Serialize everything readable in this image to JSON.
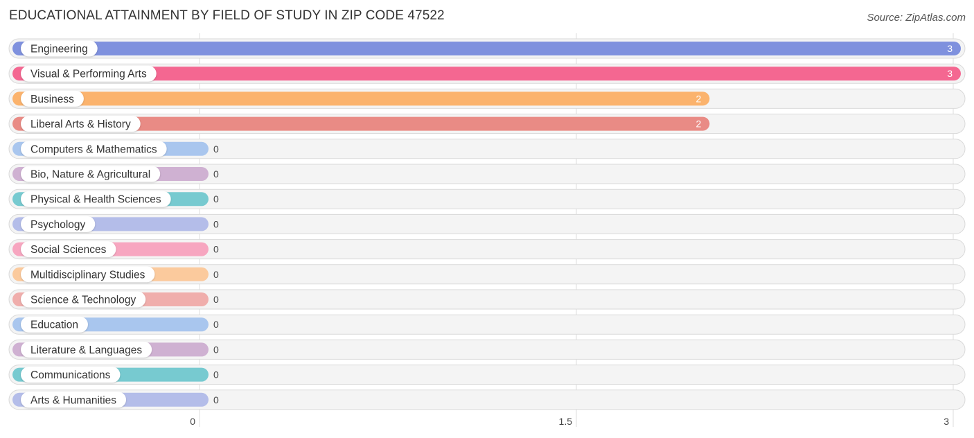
{
  "chart_data": {
    "type": "bar",
    "orientation": "horizontal",
    "title": "EDUCATIONAL ATTAINMENT BY FIELD OF STUDY IN ZIP CODE 47522",
    "source": "Source: ZipAtlas.com",
    "xlabel": "",
    "ylabel": "",
    "xlim": [
      0,
      3
    ],
    "xticks": [
      0,
      1.5,
      3
    ],
    "xtick_labels": [
      "0",
      "1.5",
      "3"
    ],
    "grid": true,
    "legend": "none",
    "categories": [
      "Engineering",
      "Visual & Performing Arts",
      "Business",
      "Liberal Arts & History",
      "Computers & Mathematics",
      "Bio, Nature & Agricultural",
      "Physical & Health Sciences",
      "Psychology",
      "Social Sciences",
      "Multidisciplinary Studies",
      "Science & Technology",
      "Education",
      "Literature & Languages",
      "Communications",
      "Arts & Humanities"
    ],
    "values": [
      3,
      3,
      2,
      2,
      0,
      0,
      0,
      0,
      0,
      0,
      0,
      0,
      0,
      0,
      0
    ],
    "value_labels": [
      "3",
      "3",
      "2",
      "2",
      "0",
      "0",
      "0",
      "0",
      "0",
      "0",
      "0",
      "0",
      "0",
      "0",
      "0"
    ],
    "colors": [
      "#7f91de",
      "#f46791",
      "#fbb36d",
      "#e98b85",
      "#a9c6ee",
      "#cfb1d2",
      "#77cad0",
      "#b4bde9",
      "#f7a6c0",
      "#fbca9d",
      "#f0aeac",
      "#a9c6ee",
      "#cfb1d2",
      "#77cad0",
      "#b4bde9"
    ]
  }
}
